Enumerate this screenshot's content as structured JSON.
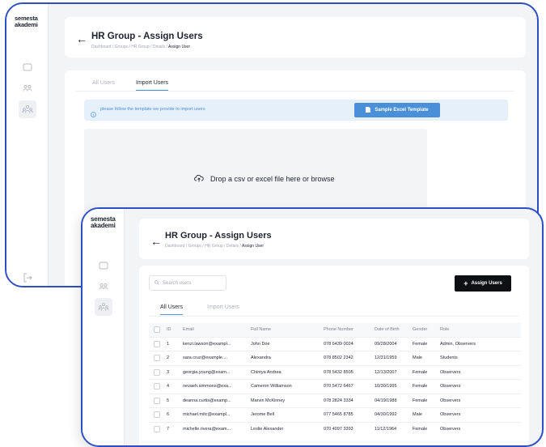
{
  "back_window": {
    "logo": [
      "semesta",
      "akademi"
    ],
    "title": "HR Group - Assign Users",
    "breadcrumb": "Dashboard / Groups / HR Group / Details / ",
    "breadcrumb_current": "Assign User",
    "tabs": [
      "All Users",
      "Import Users"
    ],
    "info_text": "please follow the template we provide to import users",
    "template_button": "Sample Excel Template",
    "dropzone_text": "Drop a csv or excel file here or browse"
  },
  "front_window": {
    "logo": [
      "semesta",
      "akademi"
    ],
    "title": "HR Group - Assign Users",
    "breadcrumb": "Dashboard / Groups / HR Group / Details / ",
    "breadcrumb_current": "Assign User",
    "search_placeholder": "Search users",
    "assign_button": "Assign Users",
    "tabs": [
      "All Users",
      "Import Users"
    ],
    "table": {
      "headers": [
        "ID",
        "Email",
        "Full Name",
        "Phone Number",
        "Date of Birth",
        "Gender",
        "Role"
      ],
      "rows": [
        [
          "1",
          "kenzi.lawson@exampl...",
          "John Doe",
          "078 6439 0024",
          "09/28/2004",
          "Female",
          "Admin, Observers"
        ],
        [
          "2",
          "sara.cruz@example....",
          "Alexandra",
          "078 8502 2342",
          "12/31/1959",
          "Male",
          "Students"
        ],
        [
          "3",
          "georgia.young@exam...",
          "Chintya Andrea",
          "078 5432 8505",
          "12/13/2007",
          "Female",
          "Observers"
        ],
        [
          "4",
          "nevaeh.simmons@exa...",
          "Cameron Williamson",
          "070 5472 6467",
          "10/30/1995",
          "Female",
          "Observers"
        ],
        [
          "5",
          "deanna.curtis@examp...",
          "Marvin McKinney",
          "078 2824 3334",
          "04/19/1988",
          "Female",
          "Observers"
        ],
        [
          "6",
          "michael.mitc@exampl...",
          "Jerome Bell",
          "077 5465 8785",
          "04/30/1992",
          "Male",
          "Observers"
        ],
        [
          "7",
          "michelle.rivera@exam...",
          "Leslie Alexander",
          "070 4097 3393",
          "11/12/1964",
          "Female",
          "Observers"
        ]
      ]
    }
  },
  "icons": {
    "sidebar": [
      "monitor-icon",
      "users-icon",
      "group-icon"
    ],
    "logout": "logout-icon",
    "back": "arrow-left-icon",
    "info": "info-icon",
    "excel": "file-icon",
    "upload": "cloud-upload-icon",
    "search": "search-icon",
    "plus": "plus-icon"
  },
  "colors": {
    "frame_border": "#2d4fc4",
    "accent": "#4a90d9",
    "info_bg": "#e6f0fa",
    "primary_dark": "#0e0f12"
  }
}
